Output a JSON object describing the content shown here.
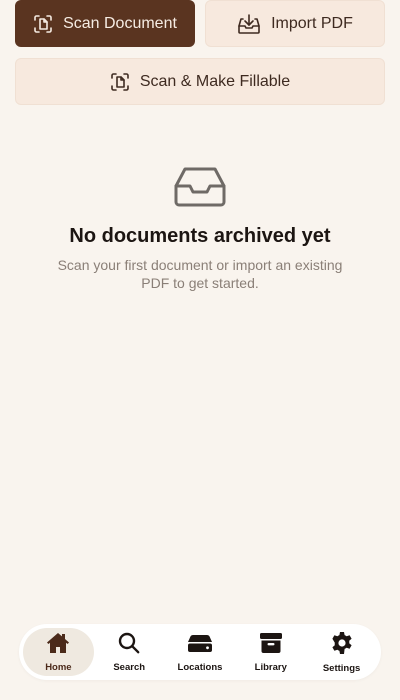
{
  "actions": {
    "scan_document": "Scan Document",
    "import_pdf": "Import PDF",
    "scan_make_fillable": "Scan & Make Fillable"
  },
  "empty_state": {
    "icon": "inbox-tray-icon",
    "title": "No documents archived yet",
    "subtitle": "Scan your first document or import an existing PDF to get started."
  },
  "tabbar": {
    "active": "Home",
    "tabs": [
      {
        "label": "Home",
        "icon": "home-icon"
      },
      {
        "label": "Search",
        "icon": "search-icon"
      },
      {
        "label": "Locations",
        "icon": "drive-icon"
      },
      {
        "label": "Library",
        "icon": "archive-box-icon"
      },
      {
        "label": "Settings",
        "icon": "gear-icon"
      }
    ]
  },
  "colors": {
    "background": "#f9f4ee",
    "primary_button": "#5a3420",
    "secondary_button": "#f7e9de",
    "active_tab": "#efe9e0"
  }
}
